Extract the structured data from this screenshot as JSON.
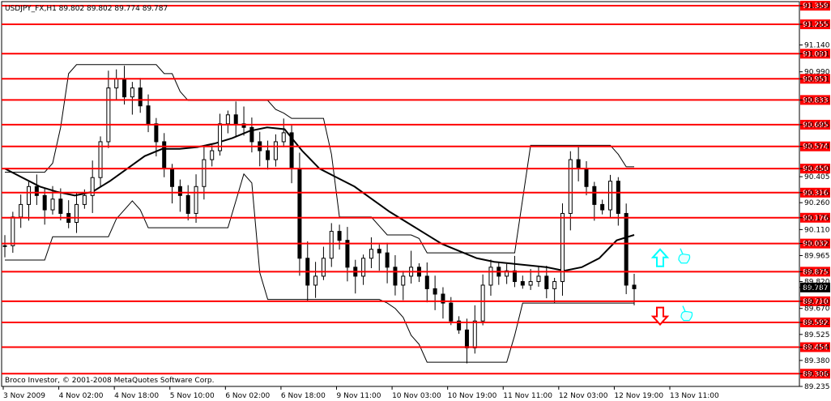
{
  "window": {
    "header": "USDJPY_FX,H1  89.802 89.802 89.774 89.787",
    "copyright": "Broco Investor, © 2001-2008 MetaQuotes Software Corp.",
    "current_price": "89.787"
  },
  "colors": {
    "level_line": "#ff0000",
    "level_label_bg": "#ff0000",
    "current_label_bg": "#000000",
    "candles": "#000000",
    "moving_average": "#000000",
    "bollinger": "#000000",
    "buy_arrow": "#00ffff",
    "sell_arrow": "#ff0000"
  },
  "icons": [
    "up-arrow-icon",
    "down-arrow-icon",
    "hand-pointer-icon"
  ],
  "chart_data": {
    "type": "candlestick",
    "instrument": "USDJPY_FX",
    "timeframe": "H1",
    "ylim": [
      89.235,
      91.359
    ],
    "y_ticks": [
      "91.359",
      "91.255",
      "91.140",
      "91.091",
      "90.990",
      "90.951",
      "90.833",
      "90.695",
      "90.574",
      "90.450",
      "90.405",
      "90.316",
      "90.260",
      "90.176",
      "90.110",
      "90.032",
      "89.965",
      "89.875",
      "89.820",
      "89.787",
      "89.710",
      "89.670",
      "89.592",
      "89.525",
      "89.454",
      "89.380",
      "89.306",
      "89.235"
    ],
    "x_ticks": [
      "3 Nov 2009",
      "4 Nov 02:00",
      "4 Nov 18:00",
      "5 Nov 10:00",
      "6 Nov 02:00",
      "6 Nov 18:00",
      "9 Nov 11:00",
      "10 Nov 03:00",
      "10 Nov 19:00",
      "11 Nov 11:00",
      "12 Nov 03:00",
      "12 Nov 19:00",
      "13 Nov 11:00"
    ],
    "levels": [
      91.359,
      91.255,
      91.091,
      90.951,
      90.833,
      90.695,
      90.574,
      90.45,
      90.316,
      90.176,
      90.032,
      89.875,
      89.71,
      89.592,
      89.454,
      89.306
    ],
    "close_path": [
      90.02,
      90.18,
      90.25,
      90.35,
      90.3,
      90.22,
      90.28,
      90.2,
      90.15,
      90.25,
      90.3,
      90.4,
      90.6,
      90.9,
      90.95,
      90.85,
      90.9,
      90.8,
      90.7,
      90.6,
      90.45,
      90.35,
      90.3,
      90.2,
      90.35,
      90.5,
      90.55,
      90.7,
      90.75,
      90.7,
      90.68,
      90.6,
      90.55,
      90.5,
      90.6,
      90.65,
      90.45,
      89.95,
      89.8,
      89.85,
      89.95,
      90.1,
      90.05,
      89.9,
      89.85,
      89.95,
      90.0,
      89.98,
      89.9,
      89.8,
      89.85,
      89.9,
      89.85,
      89.78,
      89.75,
      89.7,
      89.6,
      89.55,
      89.45,
      89.6,
      89.8,
      89.9,
      89.85,
      89.88,
      89.82,
      89.8,
      89.82,
      89.85,
      89.78,
      89.82,
      90.2,
      90.5,
      90.45,
      90.35,
      90.25,
      90.22,
      90.38,
      90.2,
      89.8,
      89.78
    ],
    "moving_average": [
      90.45,
      90.4,
      90.35,
      90.32,
      90.3,
      90.32,
      90.38,
      90.45,
      90.52,
      90.56,
      90.56,
      90.57,
      90.59,
      90.62,
      90.66,
      90.68,
      90.67,
      90.55,
      90.45,
      90.4,
      90.35,
      90.28,
      90.21,
      90.15,
      90.09,
      90.03,
      89.99,
      89.95,
      89.93,
      89.92,
      89.91,
      89.9,
      89.88,
      89.9,
      89.95,
      90.05,
      90.08
    ]
  },
  "markers": {
    "buy_signal_y": 89.95,
    "sell_signal_y": 89.63
  }
}
